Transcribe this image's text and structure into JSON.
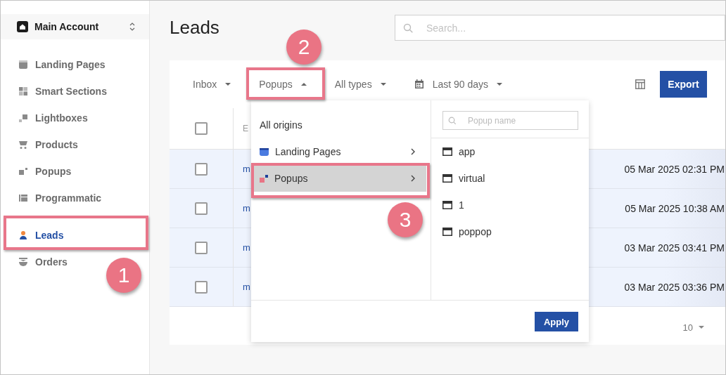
{
  "sidebar": {
    "account": "Main Account",
    "items": [
      {
        "label": "Landing Pages",
        "selected": false
      },
      {
        "label": "Smart Sections",
        "selected": false
      },
      {
        "label": "Lightboxes",
        "selected": false
      },
      {
        "label": "Products",
        "selected": false
      },
      {
        "label": "Popups",
        "selected": false
      },
      {
        "label": "Programmatic",
        "selected": false
      },
      {
        "label": "Leads",
        "selected": true
      },
      {
        "label": "Orders",
        "selected": false
      }
    ]
  },
  "page_title": "Leads",
  "search": {
    "placeholder": "Search..."
  },
  "filters": [
    {
      "label": "Inbox",
      "open": false
    },
    {
      "label": "Popups",
      "open": true
    },
    {
      "label": "All types",
      "open": false
    },
    {
      "label": "Last 90 days",
      "open": false
    }
  ],
  "export_button": "Export",
  "table": {
    "header_checked": false,
    "columns": [
      "E"
    ],
    "rows": [
      {
        "checked": false,
        "column_1": "m",
        "date": "05 Mar 2025 02:31 PM"
      },
      {
        "checked": false,
        "column_1": "m",
        "date": "05 Mar 2025 10:38 AM"
      },
      {
        "checked": false,
        "column_1": "m",
        "date": "03 Mar 2025 03:41 PM"
      },
      {
        "checked": false,
        "column_1": "m",
        "date": "03 Mar 2025 03:36 PM"
      }
    ]
  },
  "page_size": "10",
  "origin_menu": {
    "origins": [
      {
        "label": "All origins",
        "selected": false,
        "kind": "all"
      },
      {
        "label": "Landing Pages",
        "selected": false,
        "kind": "landing"
      },
      {
        "label": "Popups",
        "selected": true,
        "kind": "popup"
      }
    ],
    "search": {
      "placeholder": "Popup name"
    },
    "popups": [
      "app",
      "virtual",
      "1",
      "poppop"
    ],
    "apply_button": "Apply"
  },
  "annotations": [
    {
      "number": "1"
    },
    {
      "number": "2"
    },
    {
      "number": "3"
    }
  ]
}
